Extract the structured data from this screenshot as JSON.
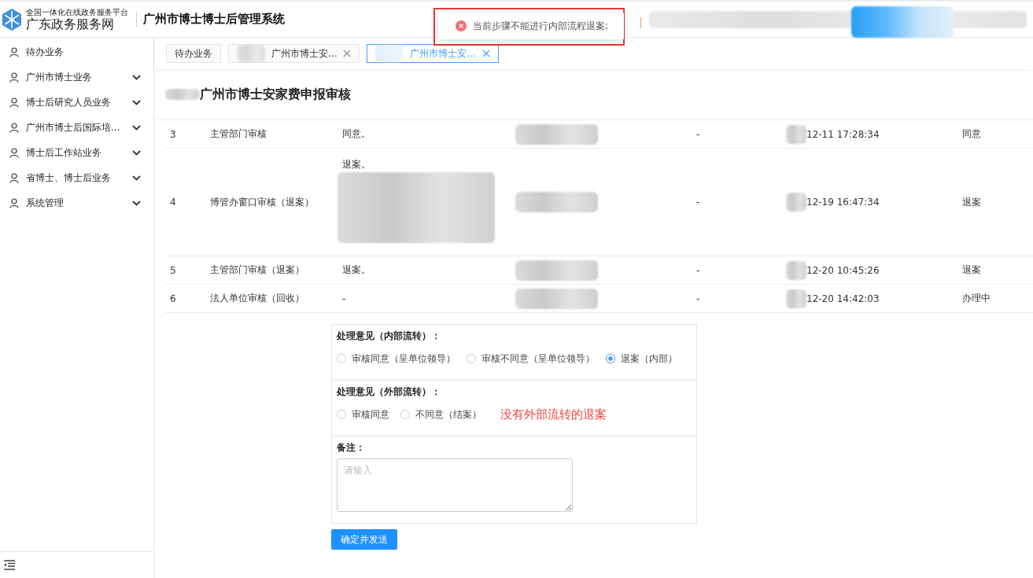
{
  "header": {
    "portal_tagline": "全国一体化在线政务服务平台",
    "portal_name": "广东政务服务网",
    "system_title": "广州市博士博士后管理系统"
  },
  "toast": {
    "kind": "error",
    "message": "当前步骤不能进行内部流程退案;"
  },
  "sidebar": {
    "items": [
      {
        "label": "待办业务",
        "expandable": false
      },
      {
        "label": "广州市博士业务",
        "expandable": true
      },
      {
        "label": "博士后研究人员业务",
        "expandable": true
      },
      {
        "label": "广州市博士后国际培...",
        "expandable": true
      },
      {
        "label": "博士后工作站业务",
        "expandable": true
      },
      {
        "label": "省博士、博士后业务",
        "expandable": true
      },
      {
        "label": "系统管理",
        "expandable": true
      }
    ]
  },
  "tabs": [
    {
      "label": "待办业务",
      "selected": false,
      "closable": false
    },
    {
      "label": "广州市博士安...",
      "selected": false,
      "closable": true
    },
    {
      "label": "广州市博士安...",
      "selected": true,
      "closable": true
    }
  ],
  "page_title": "广州市博士安家费申报审核",
  "table": {
    "rows": [
      {
        "no": "3",
        "step": "主管部门审核",
        "opinion": "同意。",
        "column_5": "-",
        "time": "12-11 17:28:34",
        "result": "同意",
        "tall": false
      },
      {
        "no": "4",
        "step": "博管办窗口审核（退案）",
        "opinion": "退案。",
        "column_5": "-",
        "time": "12-19 16:47:34",
        "result": "退案",
        "tall": true
      },
      {
        "no": "5",
        "step": "主管部门审核（退案）",
        "opinion": "退案。",
        "column_5": "-",
        "time": "12-20 10:45:26",
        "result": "退案",
        "tall": false
      },
      {
        "no": "6",
        "step": "法人单位审核（回收）",
        "opinion": "-",
        "column_5": "-",
        "time": "12-20 14:42:03",
        "result": "办理中",
        "tall": false
      }
    ]
  },
  "form": {
    "sections": [
      {
        "label": "处理意见（内部流转）：",
        "options": [
          {
            "label": "审核同意（呈单位领导）",
            "selected": false
          },
          {
            "label": "审核不同意（呈单位领导）",
            "selected": false
          },
          {
            "label": "退案（内部）",
            "selected": true
          }
        ]
      },
      {
        "label": "处理意见（外部流转）：",
        "options": [
          {
            "label": "审核同意",
            "selected": false
          },
          {
            "label": "不同意（结案）",
            "selected": false
          }
        ],
        "annotation": "没有外部流转的退案"
      }
    ],
    "remark_label": "备注：",
    "remark_placeholder": "请输入",
    "submit": "确定并发送"
  }
}
